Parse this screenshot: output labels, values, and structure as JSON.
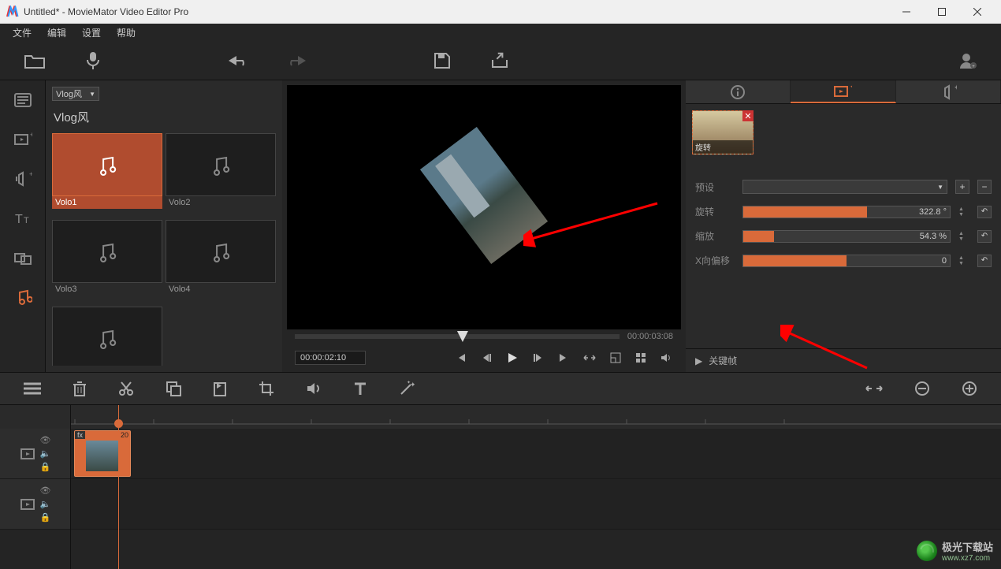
{
  "window": {
    "title": "Untitled* - MovieMator Video Editor Pro"
  },
  "menu": {
    "file": "文件",
    "edit": "编辑",
    "settings": "设置",
    "help": "帮助"
  },
  "library": {
    "dropdown": "Vlog风",
    "heading": "Vlog风",
    "items": [
      {
        "label": "Volo1",
        "selected": true
      },
      {
        "label": "Volo2",
        "selected": false
      },
      {
        "label": "Volo3",
        "selected": false
      },
      {
        "label": "Volo4",
        "selected": false
      }
    ]
  },
  "preview": {
    "duration": "00:00:03:08",
    "position": "00:00:02:10"
  },
  "props": {
    "effect_label": "旋转",
    "preset_label": "预设",
    "sliders": [
      {
        "label": "旋转",
        "value": "322.8 °",
        "fill_pct": 60
      },
      {
        "label": "缩放",
        "value": "54.3 %",
        "fill_pct": 15
      },
      {
        "label": "X向偏移",
        "value": "0",
        "fill_pct": 50
      }
    ],
    "keyframe_label": "关键帧"
  },
  "timeline": {
    "clip_num": "20"
  },
  "watermark": {
    "site_name": "极光下载站",
    "site_url": "www.xz7.com"
  },
  "colors": {
    "accent": "#d96a3a"
  }
}
